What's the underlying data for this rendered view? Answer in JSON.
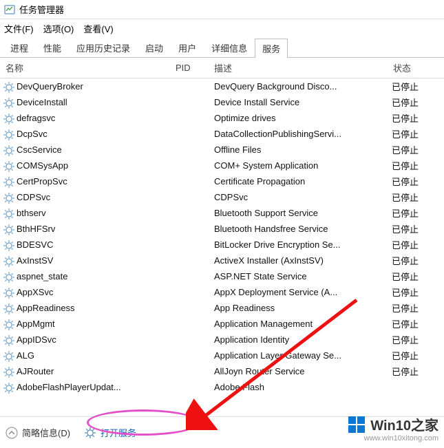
{
  "window": {
    "title": "任务管理器"
  },
  "menu": {
    "file": "文件(F)",
    "options": "选项(O)",
    "view": "查看(V)"
  },
  "tabs": {
    "processes": "进程",
    "performance": "性能",
    "apphistory": "应用历史记录",
    "startup": "启动",
    "users": "用户",
    "details": "详细信息",
    "services": "服务"
  },
  "columns": {
    "name": "名称",
    "pid": "PID",
    "desc": "描述",
    "status": "状态"
  },
  "services": [
    {
      "name": "DevQueryBroker",
      "pid": "",
      "desc": "DevQuery Background Disco...",
      "status": "已停止"
    },
    {
      "name": "DeviceInstall",
      "pid": "",
      "desc": "Device Install Service",
      "status": "已停止"
    },
    {
      "name": "defragsvc",
      "pid": "",
      "desc": "Optimize drives",
      "status": "已停止"
    },
    {
      "name": "DcpSvc",
      "pid": "",
      "desc": "DataCollectionPublishingServi...",
      "status": "已停止"
    },
    {
      "name": "CscService",
      "pid": "",
      "desc": "Offline Files",
      "status": "已停止"
    },
    {
      "name": "COMSysApp",
      "pid": "",
      "desc": "COM+ System Application",
      "status": "已停止"
    },
    {
      "name": "CertPropSvc",
      "pid": "",
      "desc": "Certificate Propagation",
      "status": "已停止"
    },
    {
      "name": "CDPSvc",
      "pid": "",
      "desc": "CDPSvc",
      "status": "已停止"
    },
    {
      "name": "bthserv",
      "pid": "",
      "desc": "Bluetooth Support Service",
      "status": "已停止"
    },
    {
      "name": "BthHFSrv",
      "pid": "",
      "desc": "Bluetooth Handsfree Service",
      "status": "已停止"
    },
    {
      "name": "BDESVC",
      "pid": "",
      "desc": "BitLocker Drive Encryption Se...",
      "status": "已停止"
    },
    {
      "name": "AxInstSV",
      "pid": "",
      "desc": "ActiveX Installer (AxInstSV)",
      "status": "已停止"
    },
    {
      "name": "aspnet_state",
      "pid": "",
      "desc": "ASP.NET State Service",
      "status": "已停止"
    },
    {
      "name": "AppXSvc",
      "pid": "",
      "desc": "AppX Deployment Service (A...",
      "status": "已停止"
    },
    {
      "name": "AppReadiness",
      "pid": "",
      "desc": "App Readiness",
      "status": "已停止"
    },
    {
      "name": "AppMgmt",
      "pid": "",
      "desc": "Application Management",
      "status": "已停止"
    },
    {
      "name": "AppIDSvc",
      "pid": "",
      "desc": "Application Identity",
      "status": "已停止"
    },
    {
      "name": "ALG",
      "pid": "",
      "desc": "Application Layer Gateway Se...",
      "status": "已停止"
    },
    {
      "name": "AJRouter",
      "pid": "",
      "desc": "AllJoyn Router Service",
      "status": "已停止"
    },
    {
      "name": "AdobeFlashPlayerUpdat...",
      "pid": "",
      "desc": "Adobe Flash",
      "status": ""
    }
  ],
  "footer": {
    "less_info": "简略信息(D)",
    "open_services": "打开服务"
  },
  "watermark": {
    "brand": "Win10之家",
    "url": "www.win10xitong.com"
  }
}
